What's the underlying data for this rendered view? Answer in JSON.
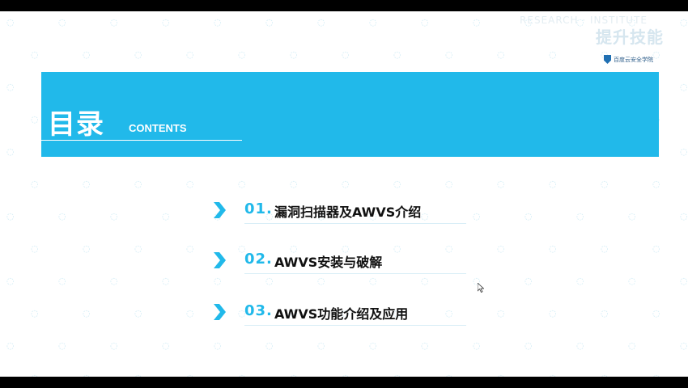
{
  "header": {
    "logo_text": "提升技能",
    "logo_sub": "RESEARCH · INSTITUTE",
    "badge_text": "百度云安全学院"
  },
  "banner": {
    "title": "目录",
    "subtitle": "CONTENTS",
    "color": "#21b9ea"
  },
  "toc": [
    {
      "num": "01.",
      "label": "漏洞扫描器及AWVS介绍"
    },
    {
      "num": "02.",
      "label": "AWVS安装与破解"
    },
    {
      "num": "03.",
      "label": "AWVS功能介绍及应用"
    }
  ],
  "icons": {
    "chevron": "chevron-right-icon",
    "cursor": "mouse-cursor-icon",
    "shield": "shield-icon"
  }
}
